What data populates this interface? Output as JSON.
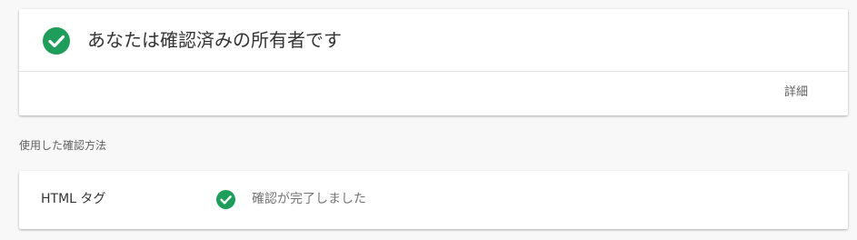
{
  "owner_card": {
    "title": "あなたは確認済みの所有者です",
    "status_icon": "check-circle-icon",
    "details_link": "詳細"
  },
  "verification_section": {
    "label": "使用した確認方法",
    "methods": [
      {
        "name": "HTML タグ",
        "status_icon": "check-circle-icon",
        "status": "確認が完了しました"
      }
    ]
  },
  "colors": {
    "success": "#1e9e5a",
    "background": "#f8f8f8",
    "card": "#ffffff"
  }
}
